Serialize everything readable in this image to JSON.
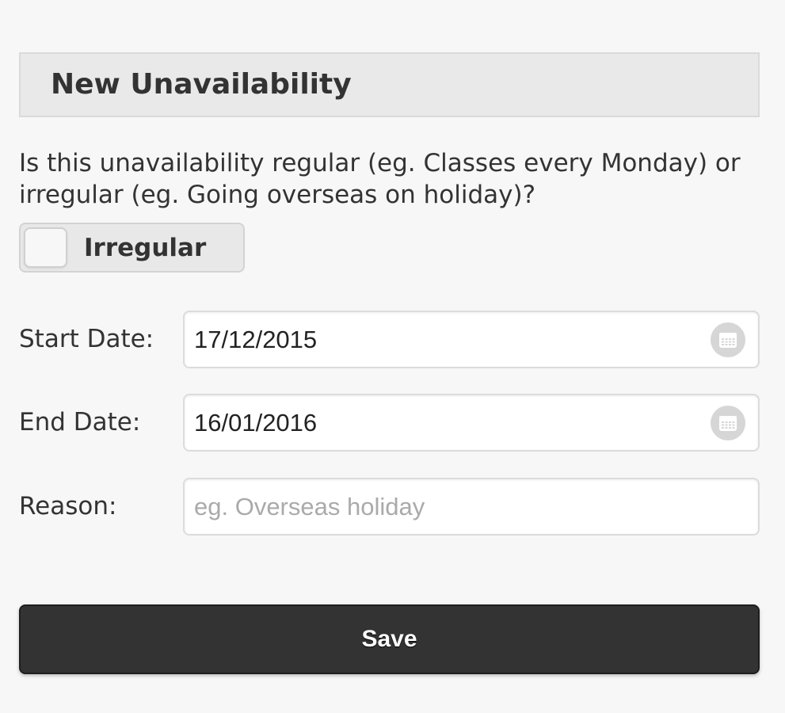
{
  "header": {
    "title": "New Unavailability"
  },
  "question": {
    "text": "Is this unavailability regular (eg. Classes every Monday) or irregular (eg. Going overseas on holiday)?"
  },
  "toggle": {
    "label": "Irregular",
    "state": "off"
  },
  "form": {
    "start_date": {
      "label": "Start Date:",
      "value": "17/12/2015",
      "icon": "calendar-icon"
    },
    "end_date": {
      "label": "End Date:",
      "value": "16/01/2016",
      "icon": "calendar-icon"
    },
    "reason": {
      "label": "Reason:",
      "value": "",
      "placeholder": "eg. Overseas holiday"
    }
  },
  "actions": {
    "save_label": "Save"
  },
  "colors": {
    "background": "#f7f7f7",
    "header_bg": "#e9e9e9",
    "button_bg": "#333333",
    "button_text": "#ffffff",
    "placeholder": "#aaaaaa",
    "calendar_icon_bg": "#d6d6d6"
  }
}
